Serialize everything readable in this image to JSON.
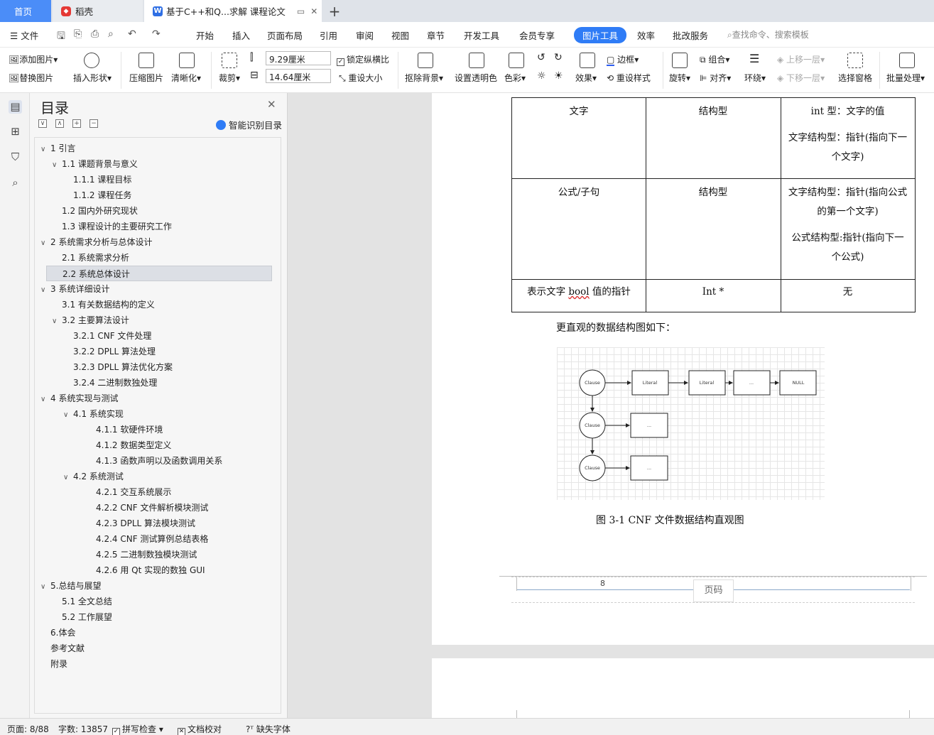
{
  "tabs": {
    "home": "首页",
    "daoke": "稻壳",
    "doc": "基于C++和Q...求解 课程论文",
    "add": "+"
  },
  "menu": {
    "file": "文件",
    "items": [
      "开始",
      "插入",
      "页面布局",
      "引用",
      "审阅",
      "视图",
      "章节",
      "开发工具",
      "会员专享"
    ],
    "active": "图片工具",
    "after": [
      "效率",
      "批改服务"
    ],
    "search": "查找命令、搜索模板"
  },
  "ribbon": {
    "add_picture": "添加图片",
    "replace_picture": "替换图片",
    "insert_shape": "插入形状",
    "compress": "压缩图片",
    "sharpen": "清晰化",
    "crop": "裁剪",
    "width": "9.29厘米",
    "height": "14.64厘米",
    "lock_ratio": "锁定纵横比",
    "reset_size": "重设大小",
    "remove_bg": "抠除背景",
    "set_transparent": "设置透明色",
    "color": "色彩",
    "effects": "效果",
    "border": "边框",
    "reset_style": "重设样式",
    "rotate": "旋转",
    "group": "组合",
    "align": "对齐",
    "wrap": "环绕",
    "bring_forward": "上移一层",
    "send_backward": "下移一层",
    "selection_pane": "选择窗格",
    "batch": "批量处理"
  },
  "toc": {
    "title": "目录",
    "smart": "智能识别目录",
    "items": [
      {
        "label": "1  引言",
        "toggle": "∨"
      },
      {
        "label": "1.1  课题背景与意义",
        "toggle": "∨"
      },
      {
        "label": "1.1.1  课程目标",
        "toggle": ""
      },
      {
        "label": "1.1.2  课程任务",
        "toggle": ""
      },
      {
        "label": "1.2  国内外研究现状",
        "toggle": ""
      },
      {
        "label": "1.3  课程设计的主要研究工作",
        "toggle": ""
      },
      {
        "label": "2  系统需求分析与总体设计",
        "toggle": "∨"
      },
      {
        "label": "2.1  系统需求分析",
        "toggle": ""
      },
      {
        "label": "2.2  系统总体设计",
        "toggle": ""
      },
      {
        "label": "3  系统详细设计",
        "toggle": "∨"
      },
      {
        "label": "3.1  有关数据结构的定义",
        "toggle": ""
      },
      {
        "label": "3.2 主要算法设计",
        "toggle": "∨"
      },
      {
        "label": "3.2.1 CNF 文件处理",
        "toggle": ""
      },
      {
        "label": "3.2.2 DPLL 算法处理",
        "toggle": ""
      },
      {
        "label": "3.2.3 DPLL 算法优化方案",
        "toggle": ""
      },
      {
        "label": "3.2.4  二进制数独处理",
        "toggle": ""
      },
      {
        "label": "4  系统实现与测试",
        "toggle": "∨"
      },
      {
        "label": "4.1  系统实现",
        "toggle": "∨"
      },
      {
        "label": "4.1.1  软硬件环境",
        "toggle": ""
      },
      {
        "label": "4.1.2  数据类型定义",
        "toggle": ""
      },
      {
        "label": "4.1.3  函数声明以及函数调用关系",
        "toggle": ""
      },
      {
        "label": "4.2  系统测试",
        "toggle": "∨"
      },
      {
        "label": "4.2.1  交互系统展示",
        "toggle": ""
      },
      {
        "label": "4.2.2 CNF 文件解析模块测试",
        "toggle": ""
      },
      {
        "label": "4.2.3 DPLL 算法模块测试",
        "toggle": ""
      },
      {
        "label": "4.2.4 CNF 测试算例总结表格",
        "toggle": ""
      },
      {
        "label": "4.2.5  二进制数独模块测试",
        "toggle": ""
      },
      {
        "label": "4.2.6 用 Qt 实现的数独 GUI",
        "toggle": ""
      },
      {
        "label": "5.总结与展望",
        "toggle": "∨"
      },
      {
        "label": "5.1  全文总结",
        "toggle": ""
      },
      {
        "label": "5.2 工作展望",
        "toggle": ""
      },
      {
        "label": "6.体会",
        "toggle": ""
      },
      {
        "label": "参考文献",
        "toggle": ""
      },
      {
        "label": "附录",
        "toggle": ""
      }
    ]
  },
  "table": {
    "rows": [
      [
        "文字",
        "结构型",
        "int 型：文字的值",
        "文字结构型：指针(指向下一个文字)"
      ],
      [
        "公式/子句",
        "结构型",
        "文字结构型：指针(指向公式的第一个文字)",
        "公式结构型:指针(指向下一个公式)"
      ],
      [
        "表示文字 bool 值的指针",
        "Int *",
        "无",
        ""
      ]
    ],
    "r1c3a": "int 型：文字的值",
    "r1c3b1": "文字结构型：指针(指向下一",
    "r1c3b2": "个文字)",
    "r2c3a1": "文字结构型：指针(指向公式",
    "r2c3a2": "的第一个文字)",
    "r2c3b1": "公式结构型:指针(指向下一",
    "r2c3b2": "个公式)",
    "r3c1a": "表示文字 ",
    "r3c1b": "bool",
    "r3c1c": " 值的指针"
  },
  "para": "更直观的数据结构图如下：",
  "diagram": {
    "clause": "Clause",
    "literal": "Literal",
    "dots": "...",
    "null": "NULL"
  },
  "caption": "图 3-1 CNF 文件数据结构直观图",
  "footer": {
    "page_number": "8",
    "page_code": "页码"
  },
  "status": {
    "page": "页面: 8/88",
    "words": "字数: 13857",
    "spell": "拼写检查",
    "proof": "文档校对",
    "missing_font": "缺失字体"
  }
}
